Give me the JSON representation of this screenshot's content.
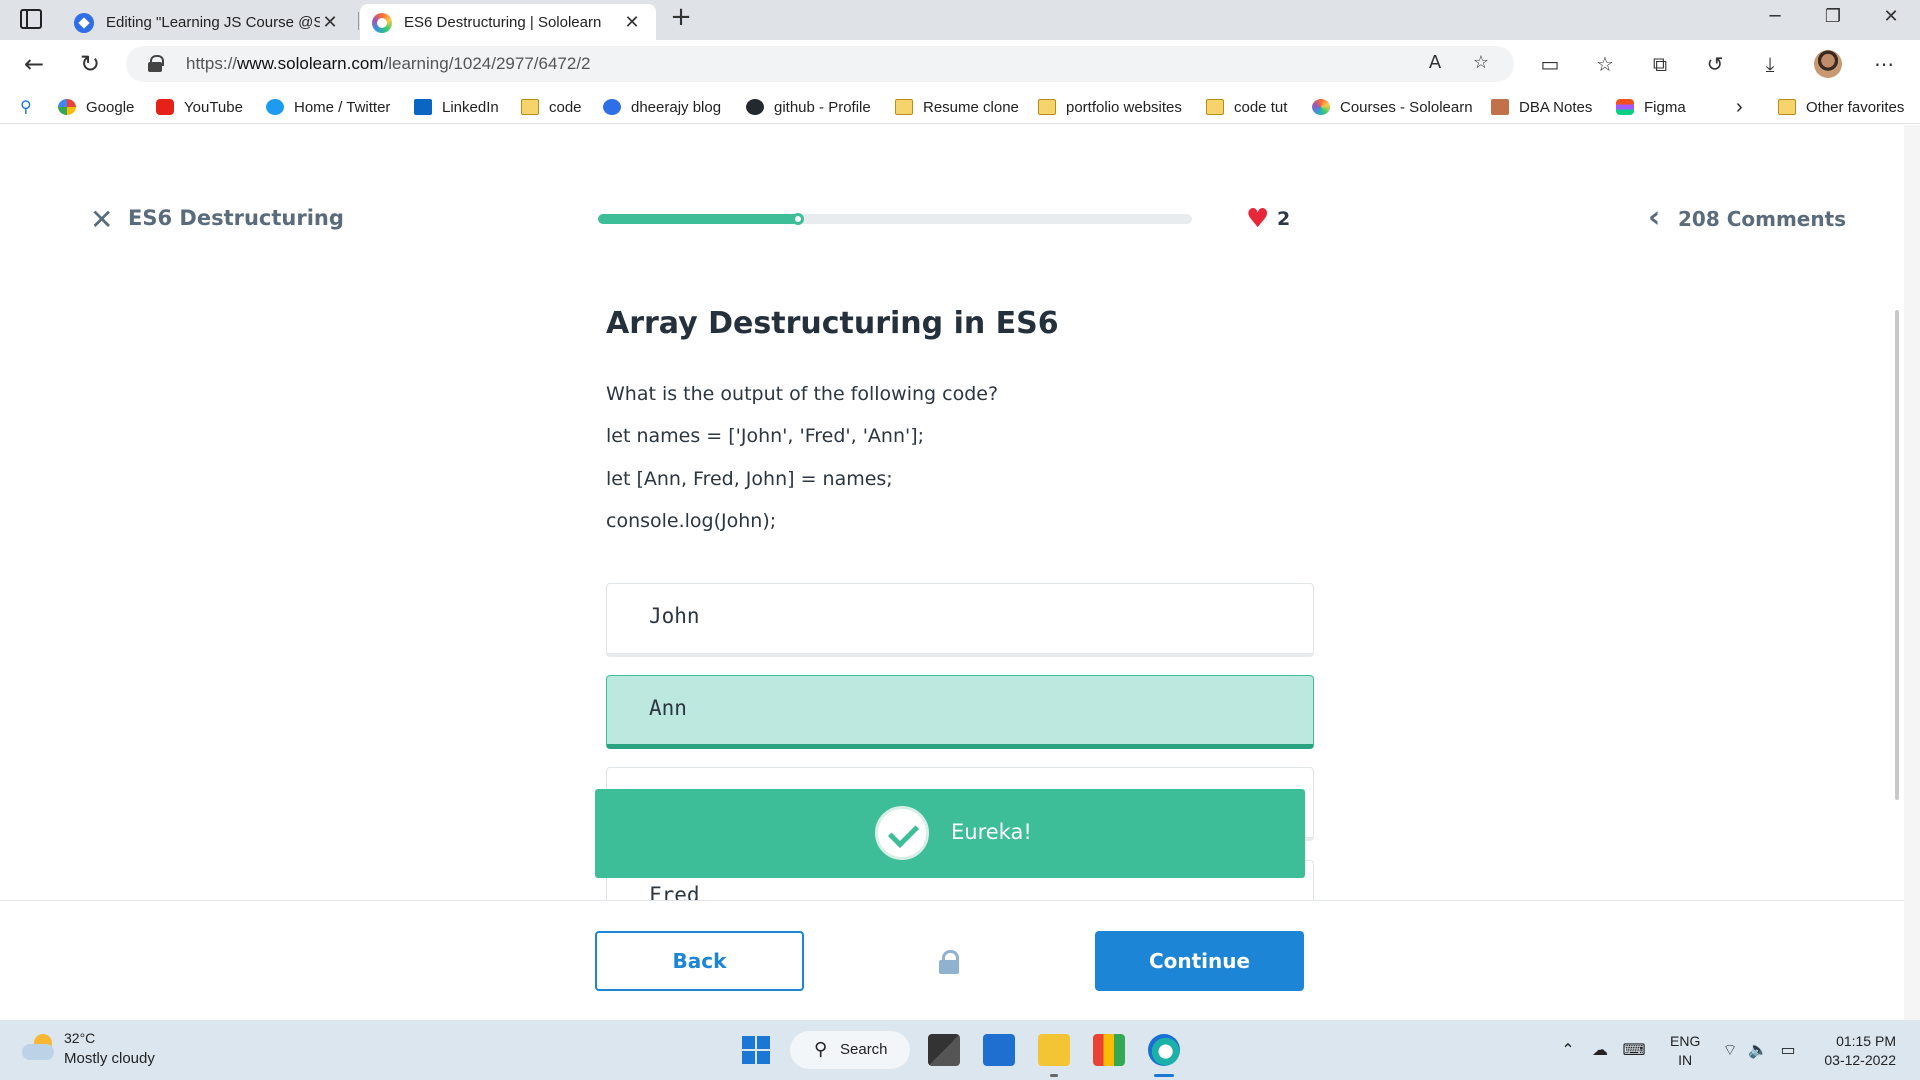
{
  "browser": {
    "tabs": [
      {
        "title": "Editing \"Learning JS Course @So",
        "active": false
      },
      {
        "title": "ES6 Destructuring | Sololearn",
        "active": true
      }
    ],
    "close_glyph": "✕",
    "new_tab_glyph": "+",
    "url_prefix": "https://",
    "url_host": "www.sololearn.com",
    "url_path": "/learning/1024/2977/6472/2",
    "bookmarks": [
      {
        "label": "Google",
        "icon": "google-icon"
      },
      {
        "label": "YouTube",
        "icon": "youtube-icon"
      },
      {
        "label": "Home / Twitter",
        "icon": "twitter-icon"
      },
      {
        "label": "LinkedIn",
        "icon": "linkedin-icon"
      },
      {
        "label": "code",
        "icon": "folder-icon"
      },
      {
        "label": "dheerajy blog",
        "icon": "blog-icon"
      },
      {
        "label": "github - Profile",
        "icon": "github-icon"
      },
      {
        "label": "Resume clone",
        "icon": "folder-icon"
      },
      {
        "label": "portfolio websites",
        "icon": "folder-icon"
      },
      {
        "label": "code tut",
        "icon": "folder-icon"
      },
      {
        "label": "Courses - Sololearn",
        "icon": "sololearn-icon"
      },
      {
        "label": "DBA Notes",
        "icon": "notes-icon"
      },
      {
        "label": "Figma",
        "icon": "figma-icon"
      }
    ],
    "other_favorites": "Other favorites"
  },
  "lesson": {
    "title": "ES6 Destructuring",
    "progress": 0.34,
    "hearts": "2",
    "comments": "208 Comments"
  },
  "question": {
    "title": "Array Destructuring in ES6",
    "lines": [
      "What is the output of the following code?",
      "let names = ['John', 'Fred', 'Ann'];",
      "let [Ann, Fred, John] = names;",
      "console.log(John);"
    ],
    "options": [
      "John",
      "Ann",
      "",
      "Fred"
    ],
    "selected_index": 1
  },
  "toast": {
    "text": "Eureka!"
  },
  "footer": {
    "back_label": "Back",
    "continue_label": "Continue"
  },
  "colors": {
    "accent_green": "#3ebd99",
    "primary_blue": "#1c85d6",
    "heart_red": "#e8263a"
  },
  "taskbar": {
    "temperature": "32°C",
    "weather": "Mostly cloudy",
    "search_label": "Search",
    "lang_top": "ENG",
    "lang_bottom": "IN",
    "time": "01:15 PM",
    "date": "03-12-2022"
  }
}
